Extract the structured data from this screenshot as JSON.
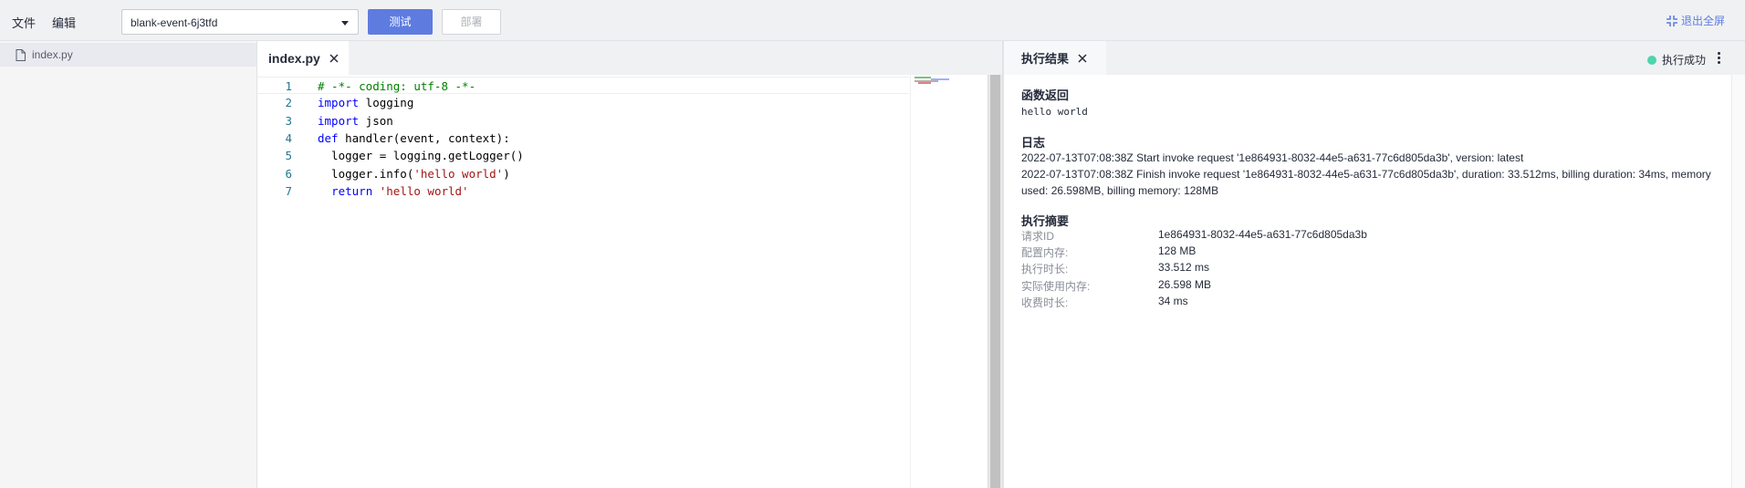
{
  "toolbar": {
    "menu": [
      {
        "label": "文件"
      },
      {
        "label": "编辑"
      }
    ],
    "event_select": {
      "value": "blank-event-6j3tfd"
    },
    "test_label": "测试",
    "deploy_label": "部署",
    "exit_fullscreen_label": "退出全屏"
  },
  "filetree": {
    "files": [
      {
        "name": "index.py",
        "icon": "file-icon"
      }
    ]
  },
  "editor": {
    "tab_label": "index.py",
    "lines": [
      {
        "num": "1",
        "tokens": [
          {
            "t": "# -*- coding: utf-8 -*-",
            "c": "comment"
          }
        ]
      },
      {
        "num": "2",
        "tokens": [
          {
            "t": "import",
            "c": "kw"
          },
          {
            "t": " logging",
            "c": ""
          }
        ]
      },
      {
        "num": "3",
        "tokens": [
          {
            "t": "import",
            "c": "kw"
          },
          {
            "t": " json",
            "c": ""
          }
        ]
      },
      {
        "num": "4",
        "tokens": [
          {
            "t": "def",
            "c": "kw"
          },
          {
            "t": " handler(event, context):",
            "c": ""
          }
        ]
      },
      {
        "num": "5",
        "tokens": [
          {
            "t": "  logger = logging.getLogger()",
            "c": ""
          }
        ]
      },
      {
        "num": "6",
        "tokens": [
          {
            "t": "  logger.info(",
            "c": ""
          },
          {
            "t": "'hello world'",
            "c": "str"
          },
          {
            "t": ")",
            "c": ""
          }
        ]
      },
      {
        "num": "7",
        "tokens": [
          {
            "t": "  ",
            "c": ""
          },
          {
            "t": "return",
            "c": "kw"
          },
          {
            "t": " ",
            "c": ""
          },
          {
            "t": "'hello world'",
            "c": "str"
          }
        ]
      }
    ]
  },
  "result": {
    "tab_label": "执行结果",
    "status_text": "执行成功",
    "status_color": "#50d4ab",
    "return_title": "函数返回",
    "return_value": "hello world",
    "log_title": "日志",
    "logs": [
      "2022-07-13T07:08:38Z Start invoke request '1e864931-8032-44e5-a631-77c6d805da3b', version: latest",
      "2022-07-13T07:08:38Z Finish invoke request '1e864931-8032-44e5-a631-77c6d805da3b', duration: 33.512ms, billing duration: 34ms, memory used: 26.598MB, billing memory: 128MB"
    ],
    "summary_title": "执行摘要",
    "summary": [
      {
        "key": "请求ID",
        "value": "1e864931-8032-44e5-a631-77c6d805da3b"
      },
      {
        "key": "配置内存:",
        "value": "128 MB"
      },
      {
        "key": "执行时长:",
        "value": "33.512 ms"
      },
      {
        "key": "实际使用内存:",
        "value": "26.598 MB"
      },
      {
        "key": "收费时长:",
        "value": "34 ms"
      }
    ]
  },
  "colors": {
    "accent": "#5e7ce0",
    "success": "#50d4ab",
    "keyword": "#0000ff",
    "string": "#a31515",
    "comment": "#008000",
    "line_number": "#237893"
  }
}
